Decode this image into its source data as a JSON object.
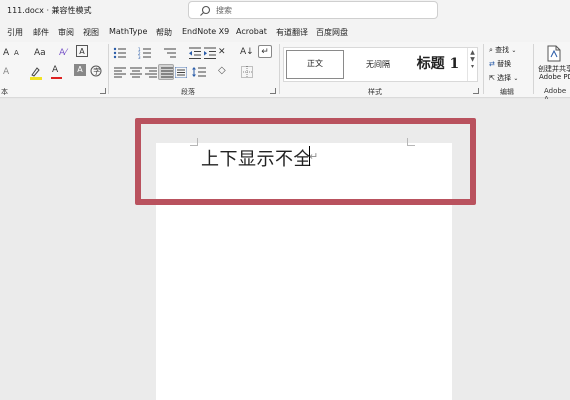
{
  "titlebar": {
    "doc_title": "111.docx  ·  兼容性模式",
    "search_placeholder": "搜索"
  },
  "menu": {
    "tabs": [
      "引用",
      "邮件",
      "审阅",
      "视图",
      "MathType",
      "帮助",
      "EndNote X9",
      "Acrobat",
      "有道翻译",
      "百度网盘"
    ]
  },
  "ribbon": {
    "font_label": "本",
    "paragraph_label": "段落",
    "styles_label": "样式",
    "editing_label": "编辑",
    "adobe_label": "Adobe A",
    "styles": {
      "normal": "正文",
      "no_spacing": "无间隔",
      "heading1": "标题 1"
    },
    "editing": {
      "find": "查找",
      "replace": "替换",
      "select": "选择"
    },
    "adobe": {
      "line1": "创建并共享",
      "line2": "Adobe PD"
    },
    "font_icons": {
      "a_grow": "A",
      "a_shrink": "A",
      "font_color": "A"
    }
  },
  "document": {
    "text": "上下显示不全"
  },
  "colors": {
    "highlight": "#b9525e"
  }
}
